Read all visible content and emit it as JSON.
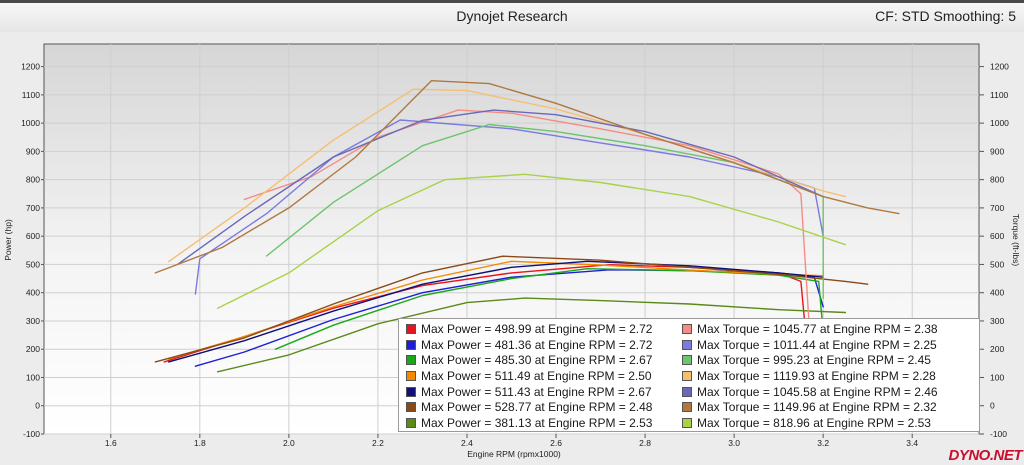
{
  "header": {
    "title": "Dynojet Research",
    "cf_label": "CF: STD Smoothing: 5"
  },
  "watermark": "DYNO.NET",
  "colors": {
    "pow": [
      "#e8141b",
      "#1e1ed8",
      "#19a819",
      "#f28a00",
      "#10107a",
      "#8a4a17",
      "#5a8a18"
    ],
    "tor": [
      "#f48c84",
      "#7a7ae0",
      "#6cc46c",
      "#f6be70",
      "#6a68b8",
      "#b07840",
      "#a8d24a"
    ]
  },
  "legend": {
    "power": [
      {
        "label": "Max Power = 498.99 at Engine RPM = 2.72"
      },
      {
        "label": "Max Power = 481.36 at Engine RPM = 2.72"
      },
      {
        "label": "Max Power = 485.30 at Engine RPM = 2.67"
      },
      {
        "label": "Max Power = 511.49 at Engine RPM = 2.50"
      },
      {
        "label": "Max Power = 511.43 at Engine RPM = 2.67"
      },
      {
        "label": "Max Power = 528.77 at Engine RPM = 2.48"
      },
      {
        "label": "Max Power = 381.13 at Engine RPM = 2.53"
      }
    ],
    "torque": [
      {
        "label": "Max Torque = 1045.77 at Engine RPM = 2.38"
      },
      {
        "label": "Max Torque = 1011.44 at Engine RPM = 2.25"
      },
      {
        "label": "Max Torque = 995.23 at Engine RPM = 2.45"
      },
      {
        "label": "Max Torque = 1119.93 at Engine RPM = 2.28"
      },
      {
        "label": "Max Torque = 1045.58 at Engine RPM = 2.46"
      },
      {
        "label": "Max Torque = 1149.96 at Engine RPM = 2.32"
      },
      {
        "label": "Max Torque = 818.96 at Engine RPM = 2.53"
      }
    ]
  },
  "chart_data": {
    "type": "line",
    "xlabel": "Engine RPM (rpmx1000)",
    "ylabel_left": "Power (hp)",
    "ylabel_right": "Torque (ft-lbs)",
    "xlim": [
      1.45,
      3.55
    ],
    "ylim": [
      -100,
      1280
    ],
    "x_ticks": [
      "1.6",
      "1.8",
      "2.0",
      "2.2",
      "2.4",
      "2.6",
      "2.8",
      "3.0",
      "3.2",
      "3.4"
    ],
    "y_ticks": [
      "-100",
      "0",
      "100",
      "200",
      "300",
      "400",
      "500",
      "600",
      "700",
      "800",
      "900",
      "1000",
      "1100",
      "1200"
    ],
    "grid": true,
    "legend_position": "bottom-right",
    "series": [
      {
        "kind": "power",
        "points": [
          [
            1.72,
            155
          ],
          [
            1.9,
            245
          ],
          [
            2.1,
            345
          ],
          [
            2.3,
            425
          ],
          [
            2.5,
            470
          ],
          [
            2.72,
            499
          ],
          [
            2.9,
            490
          ],
          [
            3.1,
            470
          ],
          [
            3.15,
            440
          ],
          [
            3.17,
            100
          ]
        ]
      },
      {
        "kind": "power",
        "points": [
          [
            1.79,
            140
          ],
          [
            1.9,
            190
          ],
          [
            2.1,
            305
          ],
          [
            2.3,
            400
          ],
          [
            2.5,
            455
          ],
          [
            2.72,
            481
          ],
          [
            2.9,
            478
          ],
          [
            3.1,
            470
          ],
          [
            3.18,
            455
          ],
          [
            3.2,
            350
          ]
        ]
      },
      {
        "kind": "power",
        "points": [
          [
            1.97,
            200
          ],
          [
            2.1,
            285
          ],
          [
            2.3,
            390
          ],
          [
            2.5,
            450
          ],
          [
            2.67,
            485
          ],
          [
            2.9,
            478
          ],
          [
            3.1,
            462
          ],
          [
            3.19,
            440
          ],
          [
            3.2,
            260
          ]
        ]
      },
      {
        "kind": "power",
        "points": [
          [
            1.73,
            165
          ],
          [
            1.9,
            245
          ],
          [
            2.1,
            350
          ],
          [
            2.3,
            445
          ],
          [
            2.5,
            511
          ],
          [
            2.7,
            498
          ],
          [
            2.9,
            480
          ],
          [
            3.1,
            465
          ],
          [
            3.2,
            460
          ]
        ]
      },
      {
        "kind": "power",
        "points": [
          [
            1.73,
            155
          ],
          [
            1.9,
            230
          ],
          [
            2.1,
            335
          ],
          [
            2.3,
            430
          ],
          [
            2.5,
            490
          ],
          [
            2.67,
            511
          ],
          [
            2.9,
            495
          ],
          [
            3.1,
            470
          ],
          [
            3.2,
            455
          ]
        ]
      },
      {
        "kind": "power",
        "points": [
          [
            1.7,
            155
          ],
          [
            1.9,
            240
          ],
          [
            2.1,
            360
          ],
          [
            2.3,
            470
          ],
          [
            2.48,
            529
          ],
          [
            2.7,
            515
          ],
          [
            2.9,
            490
          ],
          [
            3.1,
            465
          ],
          [
            3.25,
            440
          ],
          [
            3.3,
            430
          ]
        ]
      },
      {
        "kind": "power",
        "points": [
          [
            1.84,
            120
          ],
          [
            2.0,
            180
          ],
          [
            2.2,
            290
          ],
          [
            2.4,
            365
          ],
          [
            2.53,
            381
          ],
          [
            2.7,
            372
          ],
          [
            2.9,
            360
          ],
          [
            3.1,
            340
          ],
          [
            3.25,
            330
          ]
        ]
      },
      {
        "kind": "torque",
        "points": [
          [
            1.9,
            730
          ],
          [
            2.05,
            810
          ],
          [
            2.2,
            950
          ],
          [
            2.38,
            1046
          ],
          [
            2.5,
            1035
          ],
          [
            2.7,
            980
          ],
          [
            2.9,
            920
          ],
          [
            3.1,
            820
          ],
          [
            3.15,
            750
          ],
          [
            3.17,
            250
          ]
        ]
      },
      {
        "kind": "torque",
        "points": [
          [
            1.79,
            395
          ],
          [
            1.8,
            520
          ],
          [
            1.95,
            680
          ],
          [
            2.1,
            880
          ],
          [
            2.25,
            1011
          ],
          [
            2.5,
            980
          ],
          [
            2.7,
            930
          ],
          [
            2.9,
            880
          ],
          [
            3.1,
            810
          ],
          [
            3.18,
            770
          ],
          [
            3.2,
            600
          ]
        ]
      },
      {
        "kind": "torque",
        "points": [
          [
            1.95,
            530
          ],
          [
            2.1,
            720
          ],
          [
            2.3,
            920
          ],
          [
            2.45,
            995
          ],
          [
            2.6,
            970
          ],
          [
            2.8,
            920
          ],
          [
            3.0,
            860
          ],
          [
            3.2,
            740
          ],
          [
            3.2,
            380
          ]
        ]
      },
      {
        "kind": "torque",
        "points": [
          [
            1.73,
            510
          ],
          [
            1.9,
            700
          ],
          [
            2.1,
            940
          ],
          [
            2.28,
            1120
          ],
          [
            2.4,
            1115
          ],
          [
            2.6,
            1050
          ],
          [
            2.8,
            960
          ],
          [
            3.0,
            860
          ],
          [
            3.2,
            760
          ],
          [
            3.25,
            740
          ]
        ]
      },
      {
        "kind": "torque",
        "points": [
          [
            1.75,
            500
          ],
          [
            1.9,
            670
          ],
          [
            2.1,
            880
          ],
          [
            2.3,
            1010
          ],
          [
            2.46,
            1046
          ],
          [
            2.6,
            1030
          ],
          [
            2.8,
            970
          ],
          [
            3.0,
            880
          ],
          [
            3.2,
            740
          ]
        ]
      },
      {
        "kind": "torque",
        "points": [
          [
            1.7,
            470
          ],
          [
            1.85,
            560
          ],
          [
            2.0,
            700
          ],
          [
            2.15,
            880
          ],
          [
            2.32,
            1150
          ],
          [
            2.45,
            1140
          ],
          [
            2.6,
            1070
          ],
          [
            2.8,
            960
          ],
          [
            3.0,
            860
          ],
          [
            3.2,
            740
          ],
          [
            3.3,
            700
          ],
          [
            3.37,
            680
          ]
        ]
      },
      {
        "kind": "torque",
        "points": [
          [
            1.84,
            345
          ],
          [
            2.0,
            470
          ],
          [
            2.2,
            690
          ],
          [
            2.35,
            800
          ],
          [
            2.53,
            819
          ],
          [
            2.7,
            790
          ],
          [
            2.9,
            740
          ],
          [
            3.1,
            650
          ],
          [
            3.25,
            570
          ]
        ]
      }
    ]
  }
}
